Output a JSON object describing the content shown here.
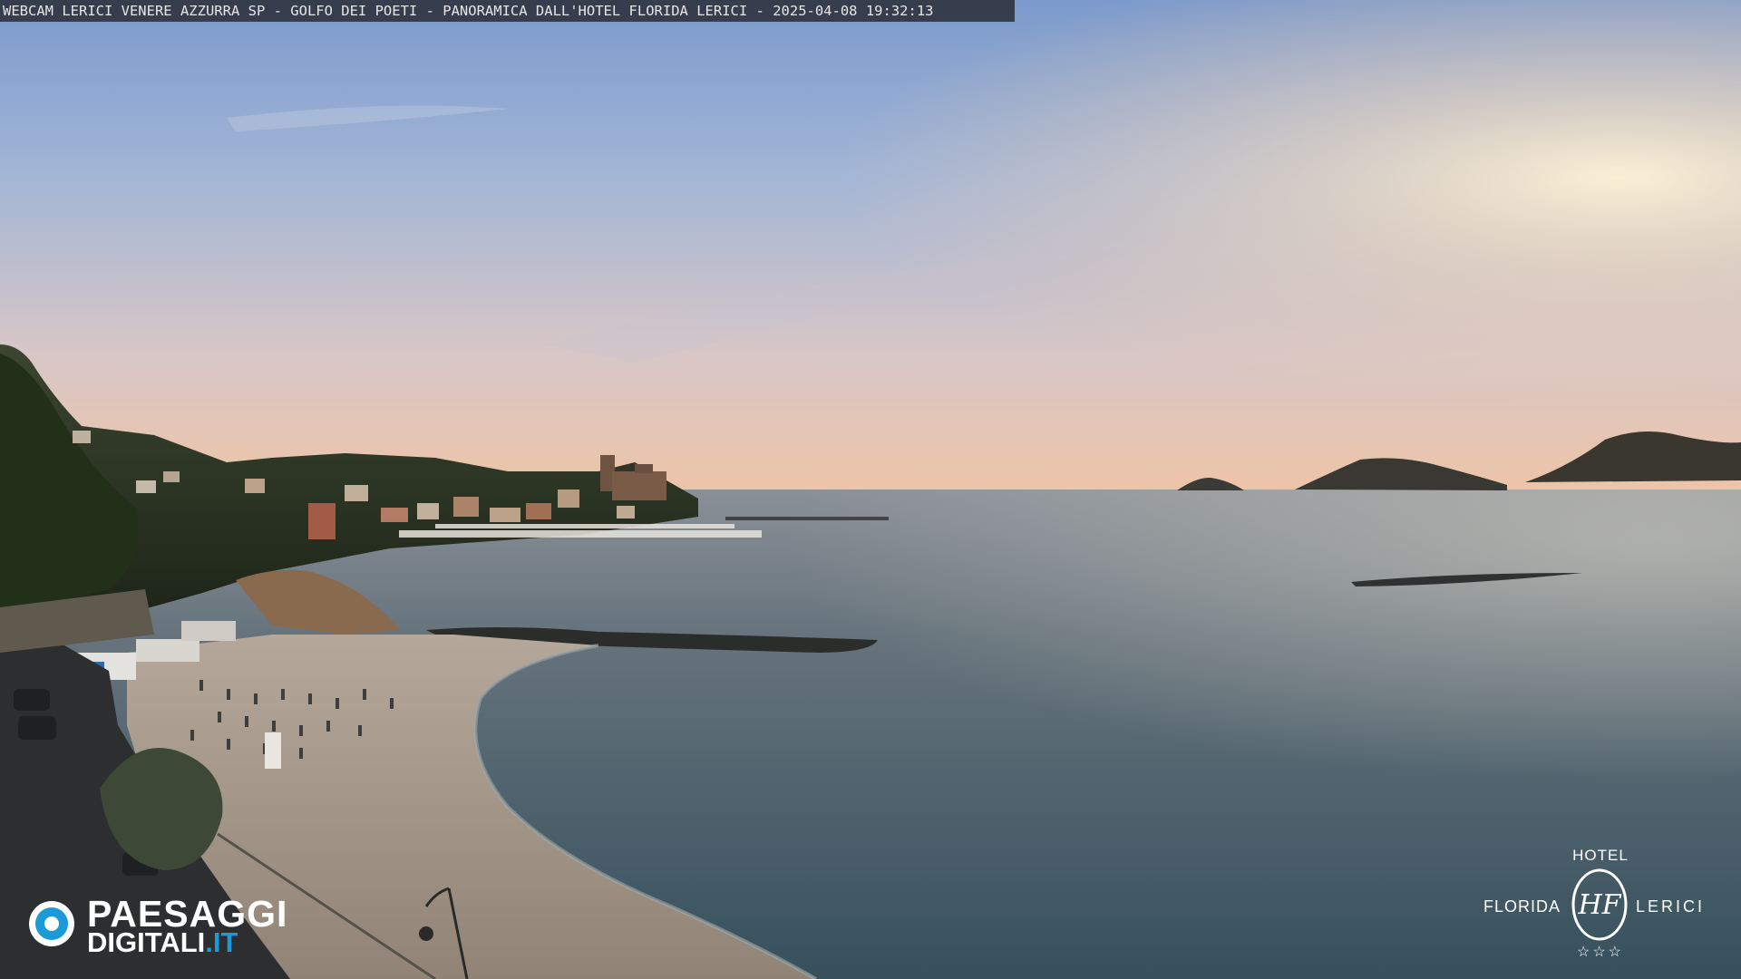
{
  "caption": "WEBCAM LERICI VENERE AZZURRA SP - GOLFO DEI POETI - PANORAMICA DALL'HOTEL FLORIDA LERICI - 2025-04-08 19:32:13",
  "brand": {
    "word1": "PAESAGGI",
    "word2_main": "DIGITALI",
    "word2_accent": ".IT",
    "icon": "eye-ring-icon",
    "accent_color": "#1a9ad6"
  },
  "hotel": {
    "top": "HOTEL",
    "left": "FLORIDA",
    "right": "LERICI",
    "stars": "☆☆☆",
    "monogram": "HF"
  },
  "scene": {
    "subject": "sunset over bay with beach, harbor and castle",
    "colors": {
      "sky_top": "#7f9dc9",
      "sky_horizon": "#f2c7a6",
      "sea": "#4b5d68",
      "sand": "#a79a8c",
      "hills": "#2a3322"
    }
  }
}
